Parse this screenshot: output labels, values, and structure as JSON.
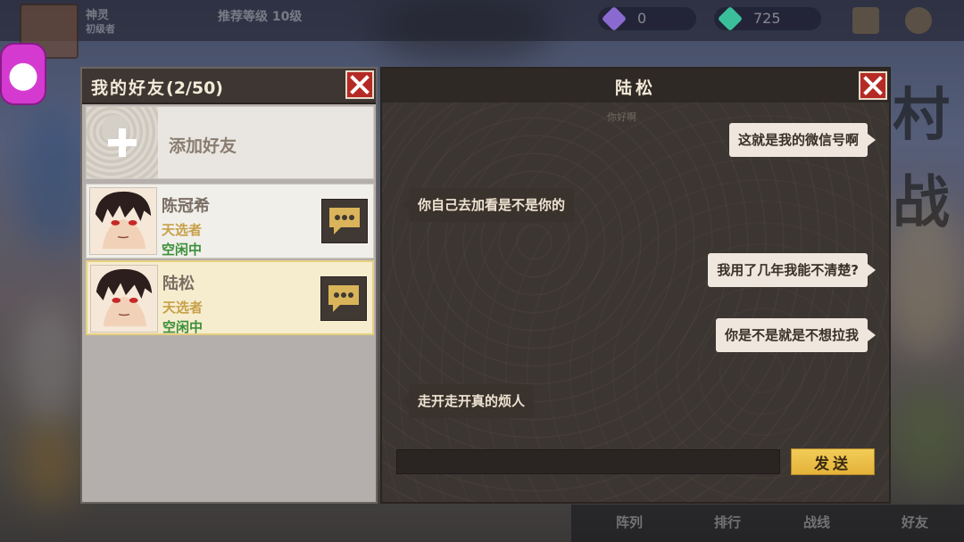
{
  "top_bar": {
    "player_name": "神灵",
    "player_sub": "初级者",
    "level_label": "推荐等级 10级",
    "currency1": "0",
    "currency2": "725"
  },
  "bottom_nav": [
    "阵列",
    "排行",
    "战线",
    "好友"
  ],
  "side_deco": [
    "村",
    "战"
  ],
  "friends": {
    "title": "我的好友",
    "count": "(2/50)",
    "add_label": "添加好友",
    "list": [
      {
        "name": "陈冠希",
        "role": "天选者",
        "status": "空闲中"
      },
      {
        "name": "陆松",
        "role": "天选者",
        "status": "空闲中"
      }
    ]
  },
  "chat": {
    "title": "陆松",
    "faded_line": "你好啊",
    "messages": [
      {
        "side": "right",
        "text": "这就是我的微信号啊"
      },
      {
        "side": "left",
        "text": "你自己去加看是不是你的"
      },
      {
        "side": "right",
        "text": "我用了几年我能不清楚?"
      },
      {
        "side": "right",
        "text": "你是不是就是不想拉我"
      },
      {
        "side": "left",
        "text": "走开走开真的烦人"
      }
    ],
    "input_value": "",
    "send_label": "发送"
  },
  "colors": {
    "close_red": "#b52a25",
    "send_gold": "#e4b33a",
    "status_green": "#3c8f3a",
    "role_gold": "#c8a04a"
  },
  "icons": [
    "close-icon",
    "plus-icon",
    "chat-bubble-icon"
  ]
}
